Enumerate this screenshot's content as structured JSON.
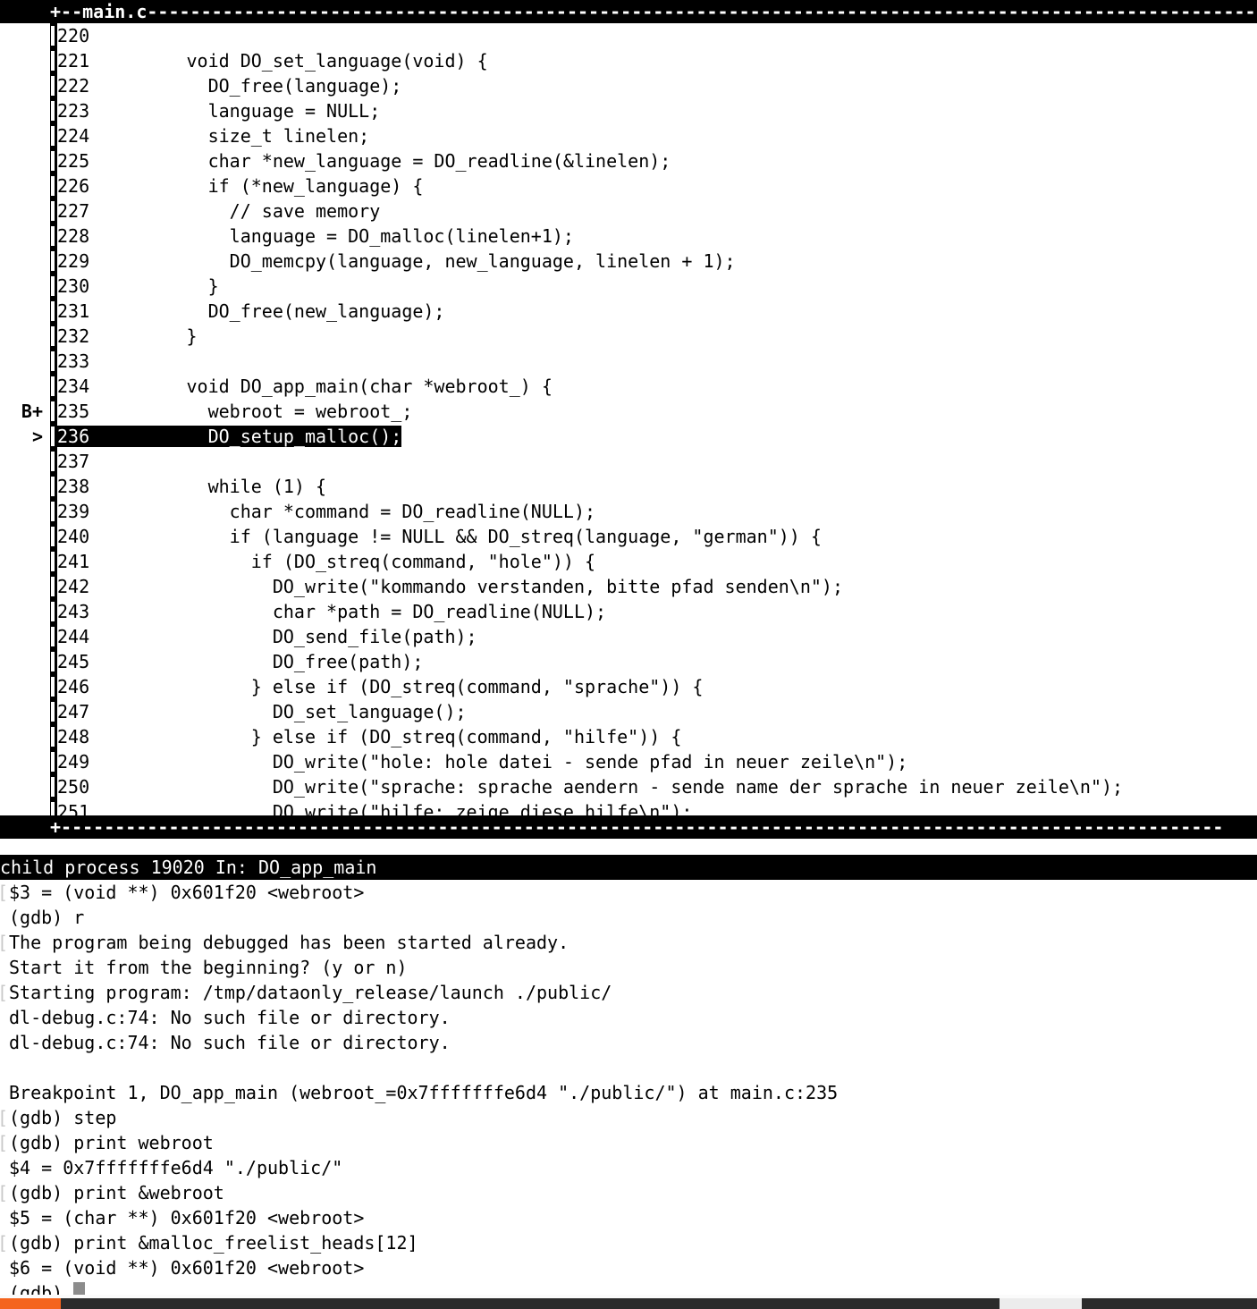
{
  "window": {
    "title": "main.c",
    "frame_corner": "+",
    "border_dash": "-",
    "border_prefix": "+--"
  },
  "colors": {
    "background": "#ffffff",
    "foreground": "#000000",
    "highlight_bg": "#000000",
    "highlight_fg": "#ffffff",
    "clipped_marker": "#c8c8c8",
    "cursor": "#8c8c8c",
    "taskbar": "#2b2b2b",
    "taskbar_accent": "#f4641e",
    "taskbar_active": "#ececec"
  },
  "source": {
    "filename": "main.c",
    "current_line": 236,
    "breakpoint_line": 235,
    "breakpoint_marker": "B+",
    "current_marker": ">",
    "lines": [
      {
        "num": "220",
        "text": "",
        "marker": ""
      },
      {
        "num": "221",
        "text": "    void DO_set_language(void) {",
        "marker": ""
      },
      {
        "num": "222",
        "text": "      DO_free(language);",
        "marker": ""
      },
      {
        "num": "223",
        "text": "      language = NULL;",
        "marker": ""
      },
      {
        "num": "224",
        "text": "      size_t linelen;",
        "marker": ""
      },
      {
        "num": "225",
        "text": "      char *new_language = DO_readline(&linelen);",
        "marker": ""
      },
      {
        "num": "226",
        "text": "      if (*new_language) {",
        "marker": ""
      },
      {
        "num": "227",
        "text": "        // save memory",
        "marker": ""
      },
      {
        "num": "228",
        "text": "        language = DO_malloc(linelen+1);",
        "marker": ""
      },
      {
        "num": "229",
        "text": "        DO_memcpy(language, new_language, linelen + 1);",
        "marker": ""
      },
      {
        "num": "230",
        "text": "      }",
        "marker": ""
      },
      {
        "num": "231",
        "text": "      DO_free(new_language);",
        "marker": ""
      },
      {
        "num": "232",
        "text": "    }",
        "marker": "",
        "clipped": true
      },
      {
        "num": "233",
        "text": "",
        "marker": ""
      },
      {
        "num": "234",
        "text": "    void DO_app_main(char *webroot_) {",
        "marker": ""
      },
      {
        "num": "235",
        "text": "      webroot = webroot_;",
        "marker": "B+"
      },
      {
        "num": "236",
        "text": "      DO_setup_malloc();",
        "marker": ">",
        "highlight": true
      },
      {
        "num": "237",
        "text": "",
        "marker": ""
      },
      {
        "num": "238",
        "text": "      while (1) {",
        "marker": ""
      },
      {
        "num": "239",
        "text": "        char *command = DO_readline(NULL);",
        "marker": ""
      },
      {
        "num": "240",
        "text": "        if (language != NULL && DO_streq(language, \"german\")) {",
        "marker": ""
      },
      {
        "num": "241",
        "text": "          if (DO_streq(command, \"hole\")) {",
        "marker": ""
      },
      {
        "num": "242",
        "text": "            DO_write(\"kommando verstanden, bitte pfad senden\\n\");",
        "marker": ""
      },
      {
        "num": "243",
        "text": "            char *path = DO_readline(NULL);",
        "marker": ""
      },
      {
        "num": "244",
        "text": "            DO_send_file(path);",
        "marker": ""
      },
      {
        "num": "245",
        "text": "            DO_free(path);",
        "marker": ""
      },
      {
        "num": "246",
        "text": "          } else if (DO_streq(command, \"sprache\")) {",
        "marker": ""
      },
      {
        "num": "247",
        "text": "            DO_set_language();",
        "marker": ""
      },
      {
        "num": "248",
        "text": "          } else if (DO_streq(command, \"hilfe\")) {",
        "marker": ""
      },
      {
        "num": "249",
        "text": "            DO_write(\"hole: hole datei - sende pfad in neuer zeile\\n\");",
        "marker": ""
      },
      {
        "num": "250",
        "text": "            DO_write(\"sprache: sprache aendern - sende name der sprache in neuer zeile\\n\");",
        "marker": "",
        "clipped": true
      },
      {
        "num": "251",
        "text": "            DO_write(\"hilfe: zeige diese hilfe\\n\");",
        "marker": ""
      }
    ]
  },
  "status_line": {
    "text": "child process 19020 In: DO_app_main",
    "process_id": "19020",
    "function": "DO_app_main"
  },
  "console": {
    "prompt": "(gdb)",
    "rows": [
      {
        "text": "$3 = (void **) 0x601f20 <webroot>",
        "clipped": true
      },
      {
        "text": "(gdb) r",
        "clipped": false
      },
      {
        "text": "The program being debugged has been started already.",
        "clipped": true
      },
      {
        "text": "Start it from the beginning? (y or n)",
        "clipped": false
      },
      {
        "text": "Starting program: /tmp/dataonly_release/launch ./public/",
        "clipped": true
      },
      {
        "text": "dl-debug.c:74: No such file or directory.",
        "clipped": false
      },
      {
        "text": "dl-debug.c:74: No such file or directory.",
        "clipped": false
      },
      {
        "text": "",
        "clipped": false
      },
      {
        "text": "Breakpoint 1, DO_app_main (webroot_=0x7fffffffe6d4 \"./public/\") at main.c:235",
        "clipped": false
      },
      {
        "text": "(gdb) step",
        "clipped": true
      },
      {
        "text": "(gdb) print webroot",
        "clipped": true
      },
      {
        "text": "$4 = 0x7fffffffe6d4 \"./public/\"",
        "clipped": false
      },
      {
        "text": "(gdb) print &webroot",
        "clipped": true
      },
      {
        "text": "$5 = (char **) 0x601f20 <webroot>",
        "clipped": false
      },
      {
        "text": "(gdb) print &malloc_freelist_heads[12]",
        "clipped": true
      },
      {
        "text": "$6 = (void **) 0x601f20 <webroot>",
        "clipped": false
      },
      {
        "text": "(gdb) ",
        "clipped": false,
        "cursor": true
      }
    ]
  },
  "taskbar": {
    "accent_label": "",
    "active_window_label": ""
  }
}
